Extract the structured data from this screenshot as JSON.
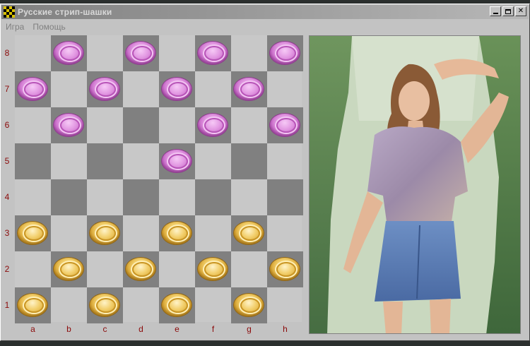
{
  "window": {
    "title": "Русские стрип-шашки",
    "menu": [
      "Игра",
      "Помощь"
    ]
  },
  "board": {
    "ranks": [
      "8",
      "7",
      "6",
      "5",
      "4",
      "3",
      "2",
      "1"
    ],
    "files": [
      "a",
      "b",
      "c",
      "d",
      "e",
      "f",
      "g",
      "h"
    ],
    "pieces": [
      {
        "square": "b8",
        "color": "pink"
      },
      {
        "square": "d8",
        "color": "pink"
      },
      {
        "square": "f8",
        "color": "pink"
      },
      {
        "square": "h8",
        "color": "pink"
      },
      {
        "square": "a7",
        "color": "pink"
      },
      {
        "square": "c7",
        "color": "pink"
      },
      {
        "square": "e7",
        "color": "pink"
      },
      {
        "square": "g7",
        "color": "pink"
      },
      {
        "square": "b6",
        "color": "pink"
      },
      {
        "square": "f6",
        "color": "pink"
      },
      {
        "square": "h6",
        "color": "pink"
      },
      {
        "square": "e5",
        "color": "pink"
      },
      {
        "square": "a3",
        "color": "gold"
      },
      {
        "square": "c3",
        "color": "gold"
      },
      {
        "square": "e3",
        "color": "gold"
      },
      {
        "square": "g3",
        "color": "gold"
      },
      {
        "square": "b2",
        "color": "gold"
      },
      {
        "square": "d2",
        "color": "gold"
      },
      {
        "square": "f2",
        "color": "gold"
      },
      {
        "square": "h2",
        "color": "gold"
      },
      {
        "square": "a1",
        "color": "gold"
      },
      {
        "square": "c1",
        "color": "gold"
      },
      {
        "square": "e1",
        "color": "gold"
      },
      {
        "square": "g1",
        "color": "gold"
      }
    ]
  },
  "colors": {
    "dark_square": "#808080",
    "light_square": "#c8c8c8",
    "label": "#8b0a0a"
  }
}
